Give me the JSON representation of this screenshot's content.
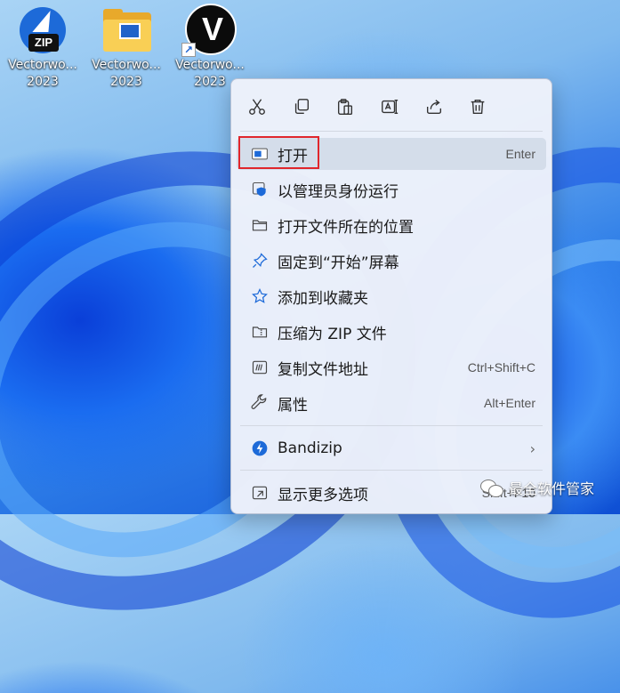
{
  "desktop": {
    "icons": [
      {
        "name": "Vectorwo...",
        "year": "2023"
      },
      {
        "name": "Vectorwo...",
        "year": "2023"
      },
      {
        "name": "Vectorwo...",
        "year": "2023"
      }
    ]
  },
  "icon_glyphs": {
    "zip_tag": "ZIP",
    "v_letter": "V",
    "shortcut_arrow": "↗"
  },
  "context_menu": {
    "toolbar": [
      "cut-icon",
      "copy-icon",
      "paste-icon",
      "rename-icon",
      "share-icon",
      "delete-icon"
    ],
    "items": [
      {
        "label": "打开",
        "shortcut": "Enter",
        "icon": "open-app-icon"
      },
      {
        "label": "以管理员身份运行",
        "shortcut": "",
        "icon": "shield-icon"
      },
      {
        "label": "打开文件所在的位置",
        "shortcut": "",
        "icon": "folder-icon"
      },
      {
        "label": "固定到“开始”屏幕",
        "shortcut": "",
        "icon": "pin-icon"
      },
      {
        "label": "添加到收藏夹",
        "shortcut": "",
        "icon": "star-icon"
      },
      {
        "label": "压缩为 ZIP 文件",
        "shortcut": "",
        "icon": "zip-folder-icon"
      },
      {
        "label": "复制文件地址",
        "shortcut": "Ctrl+Shift+C",
        "icon": "copy-path-icon"
      },
      {
        "label": "属性",
        "shortcut": "Alt+Enter",
        "icon": "wrench-icon"
      },
      {
        "label": "Bandizip",
        "shortcut": "",
        "icon": "bandizip-icon"
      },
      {
        "label": "显示更多选项",
        "shortcut": "Shift+F10",
        "icon": "expand-icon"
      }
    ],
    "submenu_chevron": "›"
  },
  "watermark": {
    "text": "最全软件管家"
  },
  "colors": {
    "accent": "#1d6ad8",
    "highlight_border": "#e0262c"
  }
}
